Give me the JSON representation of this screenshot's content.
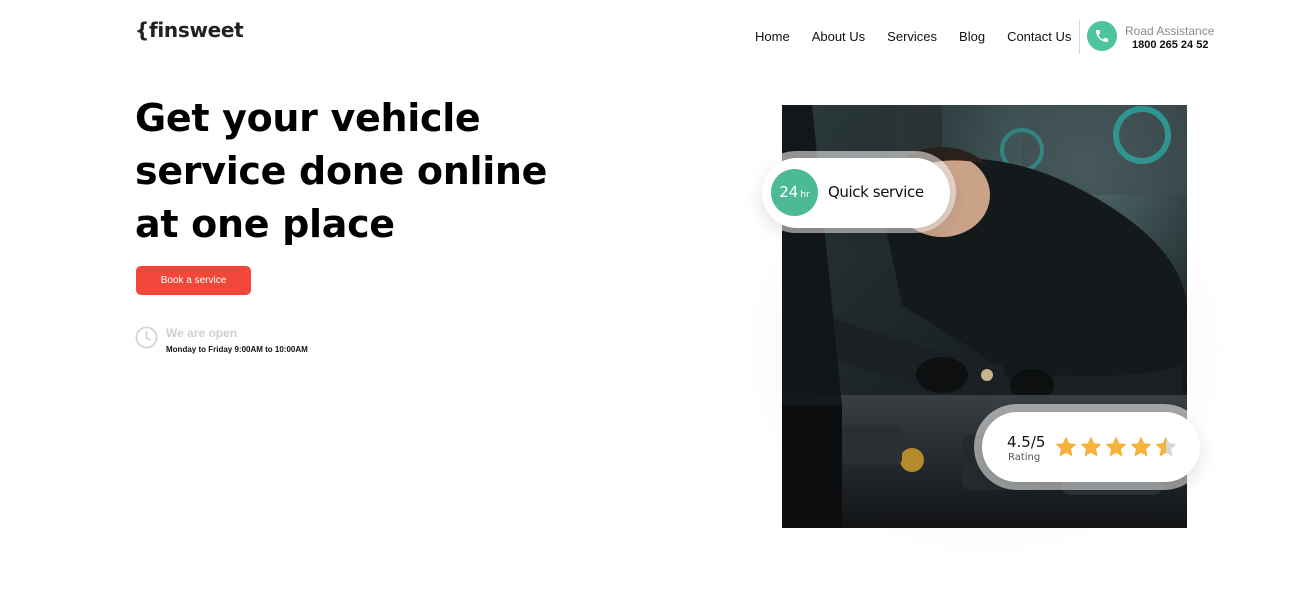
{
  "header": {
    "logo": "{finsweet",
    "nav": [
      "Home",
      "About Us",
      "Services",
      "Blog",
      "Contact Us"
    ],
    "road_assistance_label": "Road Assistance",
    "road_assistance_number": "1800 265 24 52"
  },
  "hero": {
    "title": "Get your vehicle service done online at one place",
    "cta_label": "Book a service",
    "open_label": "We are open",
    "open_hours": "Monday to Friday 9:00AM to 10:00AM"
  },
  "quick_service": {
    "hours": "24",
    "unit": "hr",
    "label": "Quick service"
  },
  "rating": {
    "value": "4.5/5",
    "label": "Rating",
    "score": 4.5,
    "max": 5
  },
  "colors": {
    "accent_green": "#4cbb93",
    "cta_red": "#f0473a",
    "star": "#f6b23b"
  },
  "icons": {
    "phone": "phone-icon",
    "clock": "clock-icon",
    "star": "star-icon"
  }
}
